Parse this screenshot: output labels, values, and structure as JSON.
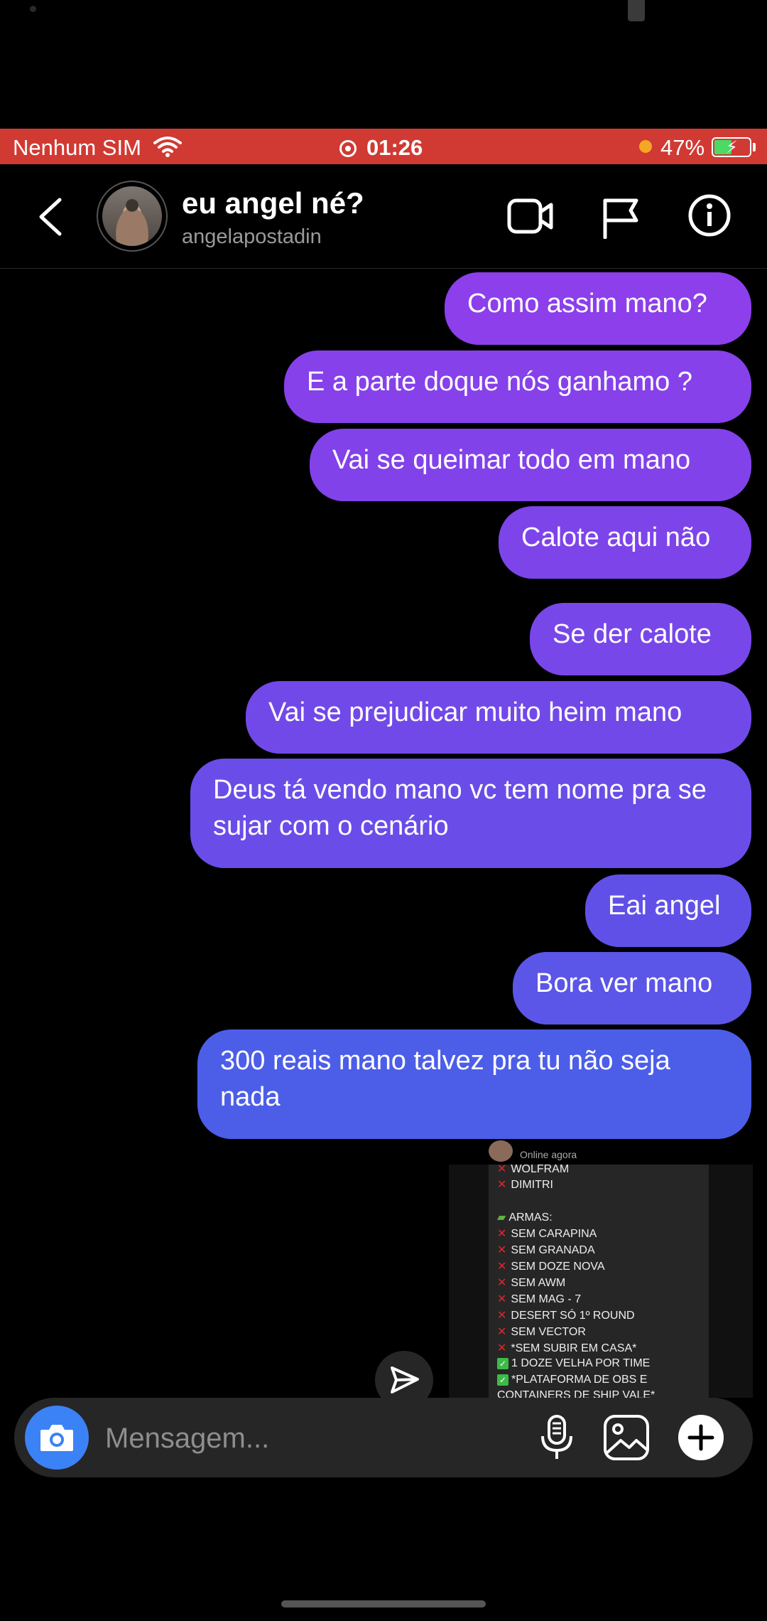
{
  "status_bar": {
    "carrier": "Nenhum SIM",
    "time": "01:26",
    "battery": "47%"
  },
  "header": {
    "name": "eu angel né?",
    "username": "angelapostadin"
  },
  "messages": [
    {
      "text": "Como assim mano?",
      "color": "#8c3fea"
    },
    {
      "text": "E a parte doque nós ganhamo ?",
      "color": "#8641ea"
    },
    {
      "text": "Vai se queimar todo em mano",
      "color": "#8242ea"
    },
    {
      "text": "Calote aqui não",
      "color": "#7d44ea"
    },
    {
      "text": "Se der calote",
      "color": "#7847e9"
    },
    {
      "text": "Vai se prejudicar muito heim mano",
      "color": "#7249e9"
    },
    {
      "text": "Deus tá vendo mano vc tem nome pra se sujar com o cenário",
      "color": "#6a4de8"
    },
    {
      "text": "Eai angel",
      "color": "#6150e8"
    },
    {
      "text": "Bora ver mano",
      "color": "#5b55e8"
    },
    {
      "text": "300 reais mano talvez pra tu não seja nada",
      "color": "#4c5ee8"
    }
  ],
  "shared_image": {
    "status": "Online agora",
    "lines": [
      {
        "mark": "x",
        "text": "WOLFRAM"
      },
      {
        "mark": "x",
        "text": "DIMITRI"
      },
      {
        "mark": "gun",
        "text": "ARMAS:"
      },
      {
        "mark": "x",
        "text": "SEM CARAPINA"
      },
      {
        "mark": "x",
        "text": "SEM GRANADA"
      },
      {
        "mark": "x",
        "text": "SEM DOZE NOVA"
      },
      {
        "mark": "x",
        "text": "SEM AWM"
      },
      {
        "mark": "x",
        "text": "SEM MAG - 7"
      },
      {
        "mark": "x",
        "text": "DESERT SÓ 1º ROUND"
      },
      {
        "mark": "x",
        "text": "SEM VECTOR"
      },
      {
        "mark": "x",
        "text": "*SEM SUBIR EM CASA*"
      },
      {
        "mark": "ok",
        "text": "1 DOZE VELHA POR TIME"
      },
      {
        "mark": "ok",
        "text": "*PLATAFORMA DE OBS E"
      },
      {
        "mark": "none",
        "text": "CONTAINERS DE SHIP VALE*"
      }
    ]
  },
  "composer": {
    "placeholder": "Mensagem..."
  }
}
